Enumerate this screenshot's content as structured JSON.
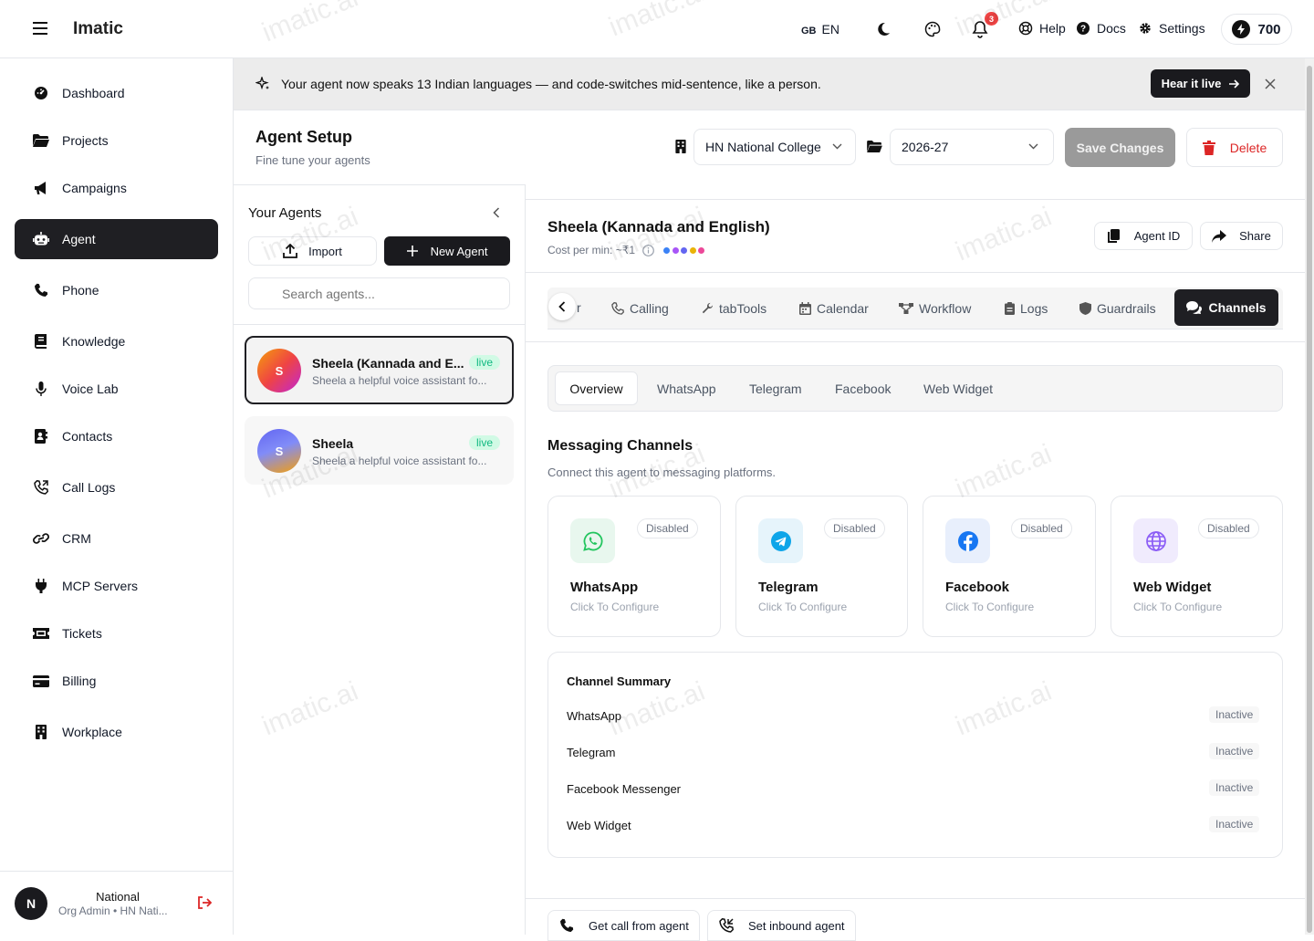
{
  "app": {
    "name": "Imatic",
    "watermark": "imatic.ai"
  },
  "topbar": {
    "lang_flag": "GB",
    "lang_code": "EN",
    "notifications_count": "3",
    "help_label": "Help",
    "docs_label": "Docs",
    "settings_label": "Settings",
    "credits": "700"
  },
  "sidebar": {
    "items": [
      {
        "label": "Dashboard",
        "icon": "dashboard-icon"
      },
      {
        "label": "Projects",
        "icon": "folder-icon"
      },
      {
        "label": "Campaigns",
        "icon": "megaphone-icon"
      },
      {
        "label": "Agent",
        "icon": "robot-icon"
      },
      {
        "label": "Phone",
        "icon": "phone-icon"
      },
      {
        "label": "Knowledge",
        "icon": "book-icon"
      },
      {
        "label": "Voice Lab",
        "icon": "microphone-icon"
      },
      {
        "label": "Contacts",
        "icon": "contacts-icon"
      },
      {
        "label": "Call Logs",
        "icon": "phone-log-icon"
      },
      {
        "label": "CRM",
        "icon": "link-icon"
      },
      {
        "label": "MCP Servers",
        "icon": "plug-icon"
      },
      {
        "label": "Tickets",
        "icon": "ticket-icon"
      },
      {
        "label": "Billing",
        "icon": "credit-card-icon"
      },
      {
        "label": "Workplace",
        "icon": "building-icon"
      }
    ],
    "active_index": 3,
    "user": {
      "initial": "N",
      "name": "National",
      "role": "Org Admin • HN Nati..."
    }
  },
  "banner": {
    "text": "Your agent now speaks 13 Indian languages — and code-switches mid-sentence, like a person.",
    "cta": "Hear it live"
  },
  "header": {
    "title": "Agent Setup",
    "subtitle": "Fine tune your agents",
    "org_select": "HN National College",
    "year_select": "2026-27",
    "save_label": "Save Changes",
    "delete_label": "Delete"
  },
  "agents_panel": {
    "title": "Your Agents",
    "import_label": "Import",
    "new_agent_label": "New Agent",
    "search_placeholder": "Search agents...",
    "agents": [
      {
        "initial": "S",
        "name": "Sheela (Kannada and E...",
        "desc": "Sheela a helpful voice assistant fo...",
        "status": "live"
      },
      {
        "initial": "S",
        "name": "Sheela",
        "desc": "Sheela a helpful voice assistant fo...",
        "status": "live"
      }
    ]
  },
  "agent": {
    "name": "Sheela (Kannada and English)",
    "cost": "Cost per min: ~₹1",
    "agent_id_label": "Agent ID",
    "share_label": "Share",
    "dot_colors": [
      "#3b82f6",
      "#a855f7",
      "#6366f1",
      "#eab308",
      "#ec4899"
    ]
  },
  "tabs": {
    "partial_label": "r",
    "items": [
      "Calling",
      "tabTools",
      "Calendar",
      "Workflow",
      "Logs",
      "Guardrails",
      "Channels"
    ],
    "active": "Channels"
  },
  "channels": {
    "sub_tabs": [
      "Overview",
      "WhatsApp",
      "Telegram",
      "Facebook",
      "Web Widget"
    ],
    "active_sub_tab": "Overview",
    "title": "Messaging Channels",
    "subtitle": "Connect this agent to messaging platforms.",
    "cards": [
      {
        "name": "WhatsApp",
        "status": "Disabled",
        "action": "Click To Configure",
        "icon": "whatsapp-icon",
        "color": "#22c55e",
        "bg": "#e8f7ee"
      },
      {
        "name": "Telegram",
        "status": "Disabled",
        "action": "Click To Configure",
        "icon": "telegram-icon",
        "color": "#0ea5e9",
        "bg": "#e6f4fb"
      },
      {
        "name": "Facebook",
        "status": "Disabled",
        "action": "Click To Configure",
        "icon": "facebook-icon",
        "color": "#1877f2",
        "bg": "#e8effc"
      },
      {
        "name": "Web Widget",
        "status": "Disabled",
        "action": "Click To Configure",
        "icon": "globe-icon",
        "color": "#8b5cf6",
        "bg": "#f0ebfd"
      }
    ],
    "summary": {
      "title": "Channel Summary",
      "rows": [
        {
          "name": "WhatsApp",
          "status": "Inactive"
        },
        {
          "name": "Telegram",
          "status": "Inactive"
        },
        {
          "name": "Facebook Messenger",
          "status": "Inactive"
        },
        {
          "name": "Web Widget",
          "status": "Inactive"
        }
      ]
    }
  },
  "footer": {
    "call_from_agent": "Get call from agent",
    "inbound_agent": "Set inbound agent"
  }
}
